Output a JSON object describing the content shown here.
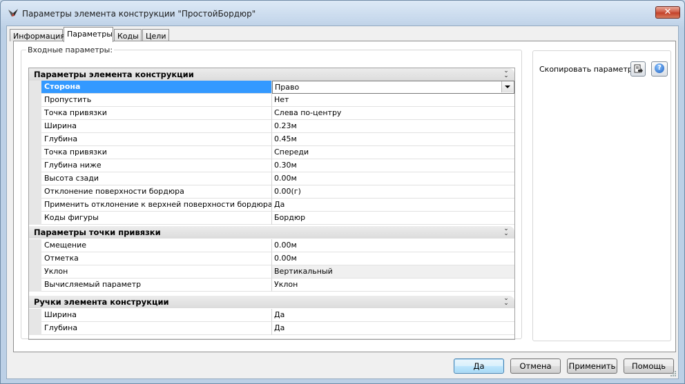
{
  "window": {
    "title": "Параметры элемента конструкции \"ПростойБордюр\"",
    "close_label": "✕"
  },
  "tabs": [
    {
      "label": "Информация",
      "active": false
    },
    {
      "label": "Параметры",
      "active": true
    },
    {
      "label": "Коды",
      "active": false
    },
    {
      "label": "Цели",
      "active": false
    }
  ],
  "input_params": {
    "legend": "Входные параметры:",
    "sections": [
      {
        "title": "Параметры элемента конструкции",
        "rows": [
          {
            "name": "Сторона",
            "value": "Право",
            "selected": true,
            "dropdown": true
          },
          {
            "name": "Пропустить",
            "value": "Нет"
          },
          {
            "name": "Точка привязки",
            "value": "Слева по-центру"
          },
          {
            "name": "Ширина",
            "value": "0.23м"
          },
          {
            "name": "Глубина",
            "value": "0.45м"
          },
          {
            "name": "Точка привязки",
            "value": "Спереди"
          },
          {
            "name": "Глубина ниже",
            "value": "0.30м"
          },
          {
            "name": "Высота сзади",
            "value": "0.00м"
          },
          {
            "name": "Отклонение поверхности бордюра",
            "value": "0.00(г)"
          },
          {
            "name": "Применить отклонение к верхней поверхности бордюра",
            "value": "Да"
          },
          {
            "name": "Коды фигуры",
            "value": "Бордюр"
          }
        ]
      },
      {
        "title": "Параметры точки привязки",
        "rows": [
          {
            "name": "Смещение",
            "value": "0.00м"
          },
          {
            "name": "Отметка",
            "value": "0.00м"
          },
          {
            "name": "Уклон",
            "value": "Вертикальный",
            "readonly": true
          },
          {
            "name": "Вычисляемый параметр",
            "value": "Уклон"
          }
        ]
      },
      {
        "title": "Ручки элемента конструкции",
        "rows": [
          {
            "name": "Ширина",
            "value": "Да"
          },
          {
            "name": "Глубина",
            "value": "Да"
          }
        ]
      }
    ]
  },
  "right_panel": {
    "copy_label": "Скопировать параметры",
    "help_glyph": "?"
  },
  "buttons": {
    "ok": "Да",
    "cancel": "Отмена",
    "apply": "Применить",
    "help": "Помощь"
  },
  "colors": {
    "selection": "#3399ff",
    "section_header": "#dcdcdc",
    "close_button": "#c4412a"
  }
}
